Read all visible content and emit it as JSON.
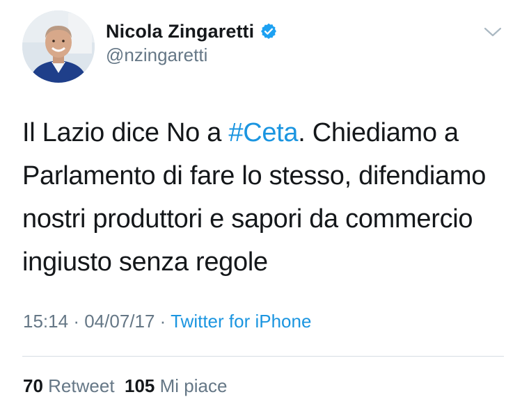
{
  "author": {
    "display_name": "Nicola Zingaretti",
    "handle": "@nzingaretti",
    "verified": true,
    "avatar_icon": "profile-photo"
  },
  "tweet": {
    "text_before_hashtag": "Il Lazio dice No a ",
    "hashtag": "#Ceta",
    "text_after_hashtag": ". Chiediamo a Parlamento di fare lo stesso, difendiamo nostri produttori e sapori da commercio ingiusto senza regole"
  },
  "meta": {
    "time": "15:14",
    "separator": "·",
    "date": "04/07/17",
    "source": "Twitter for iPhone"
  },
  "stats": {
    "retweets_count": "70",
    "retweets_label": "Retweet",
    "likes_count": "105",
    "likes_label": "Mi piace"
  },
  "colors": {
    "link": "#1b95e0",
    "secondary_text": "#657786",
    "primary_text": "#14171a",
    "verified_badge": "#1da1f2"
  }
}
